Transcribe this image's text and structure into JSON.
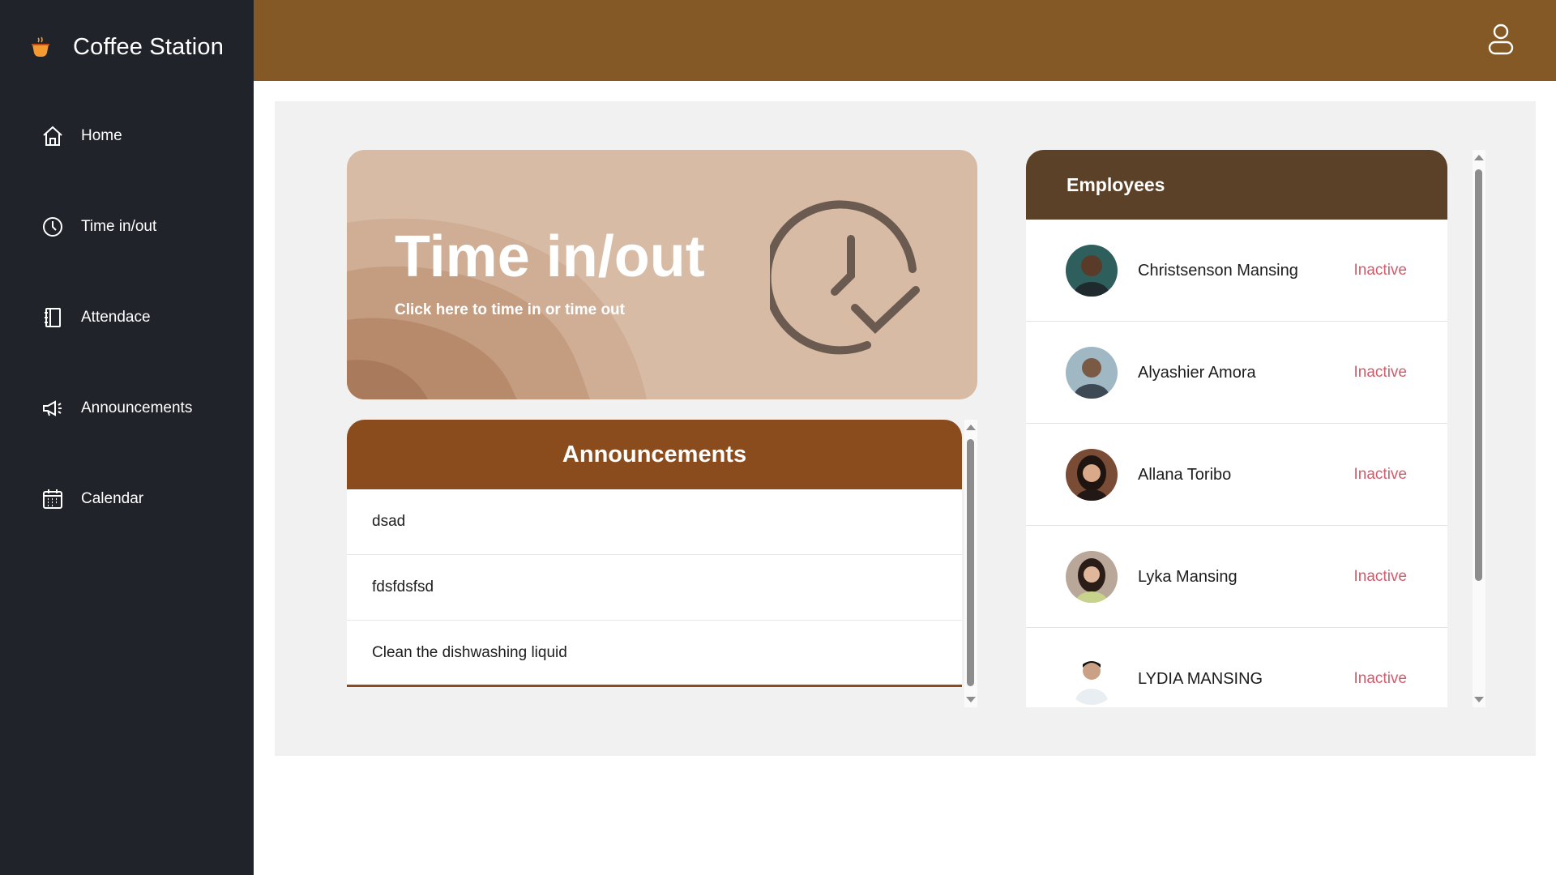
{
  "app": {
    "name": "Coffee Station",
    "brand_icon": "coffee-cup-icon",
    "accent": "#845925"
  },
  "sidebar": {
    "items": [
      {
        "label": "Home",
        "icon": "home-icon"
      },
      {
        "label": "Time in/out",
        "icon": "clock-icon"
      },
      {
        "label": "Attendace",
        "icon": "attendance-book-icon"
      },
      {
        "label": "Announcements",
        "icon": "megaphone-icon"
      },
      {
        "label": "Calendar",
        "icon": "calendar-icon"
      }
    ]
  },
  "header": {
    "user_icon": "user-icon"
  },
  "time_card": {
    "title": "Time in/out",
    "subtitle": "Click here to time in or time out",
    "icon": "clock-check-icon"
  },
  "announcements": {
    "title": "Announcements",
    "items": [
      {
        "text": "dsad"
      },
      {
        "text": "fdsfdsfsd"
      },
      {
        "text": "Clean the dishwashing liquid"
      }
    ]
  },
  "employees": {
    "title": "Employees",
    "status_color": "#d35b6b",
    "items": [
      {
        "name": "Christsenson Mansing",
        "status": "Inactive"
      },
      {
        "name": "Alyashier Amora",
        "status": "Inactive"
      },
      {
        "name": "Allana Toribo",
        "status": "Inactive"
      },
      {
        "name": "Lyka Mansing",
        "status": "Inactive"
      },
      {
        "name": "LYDIA MANSING",
        "status": "Inactive"
      }
    ]
  }
}
